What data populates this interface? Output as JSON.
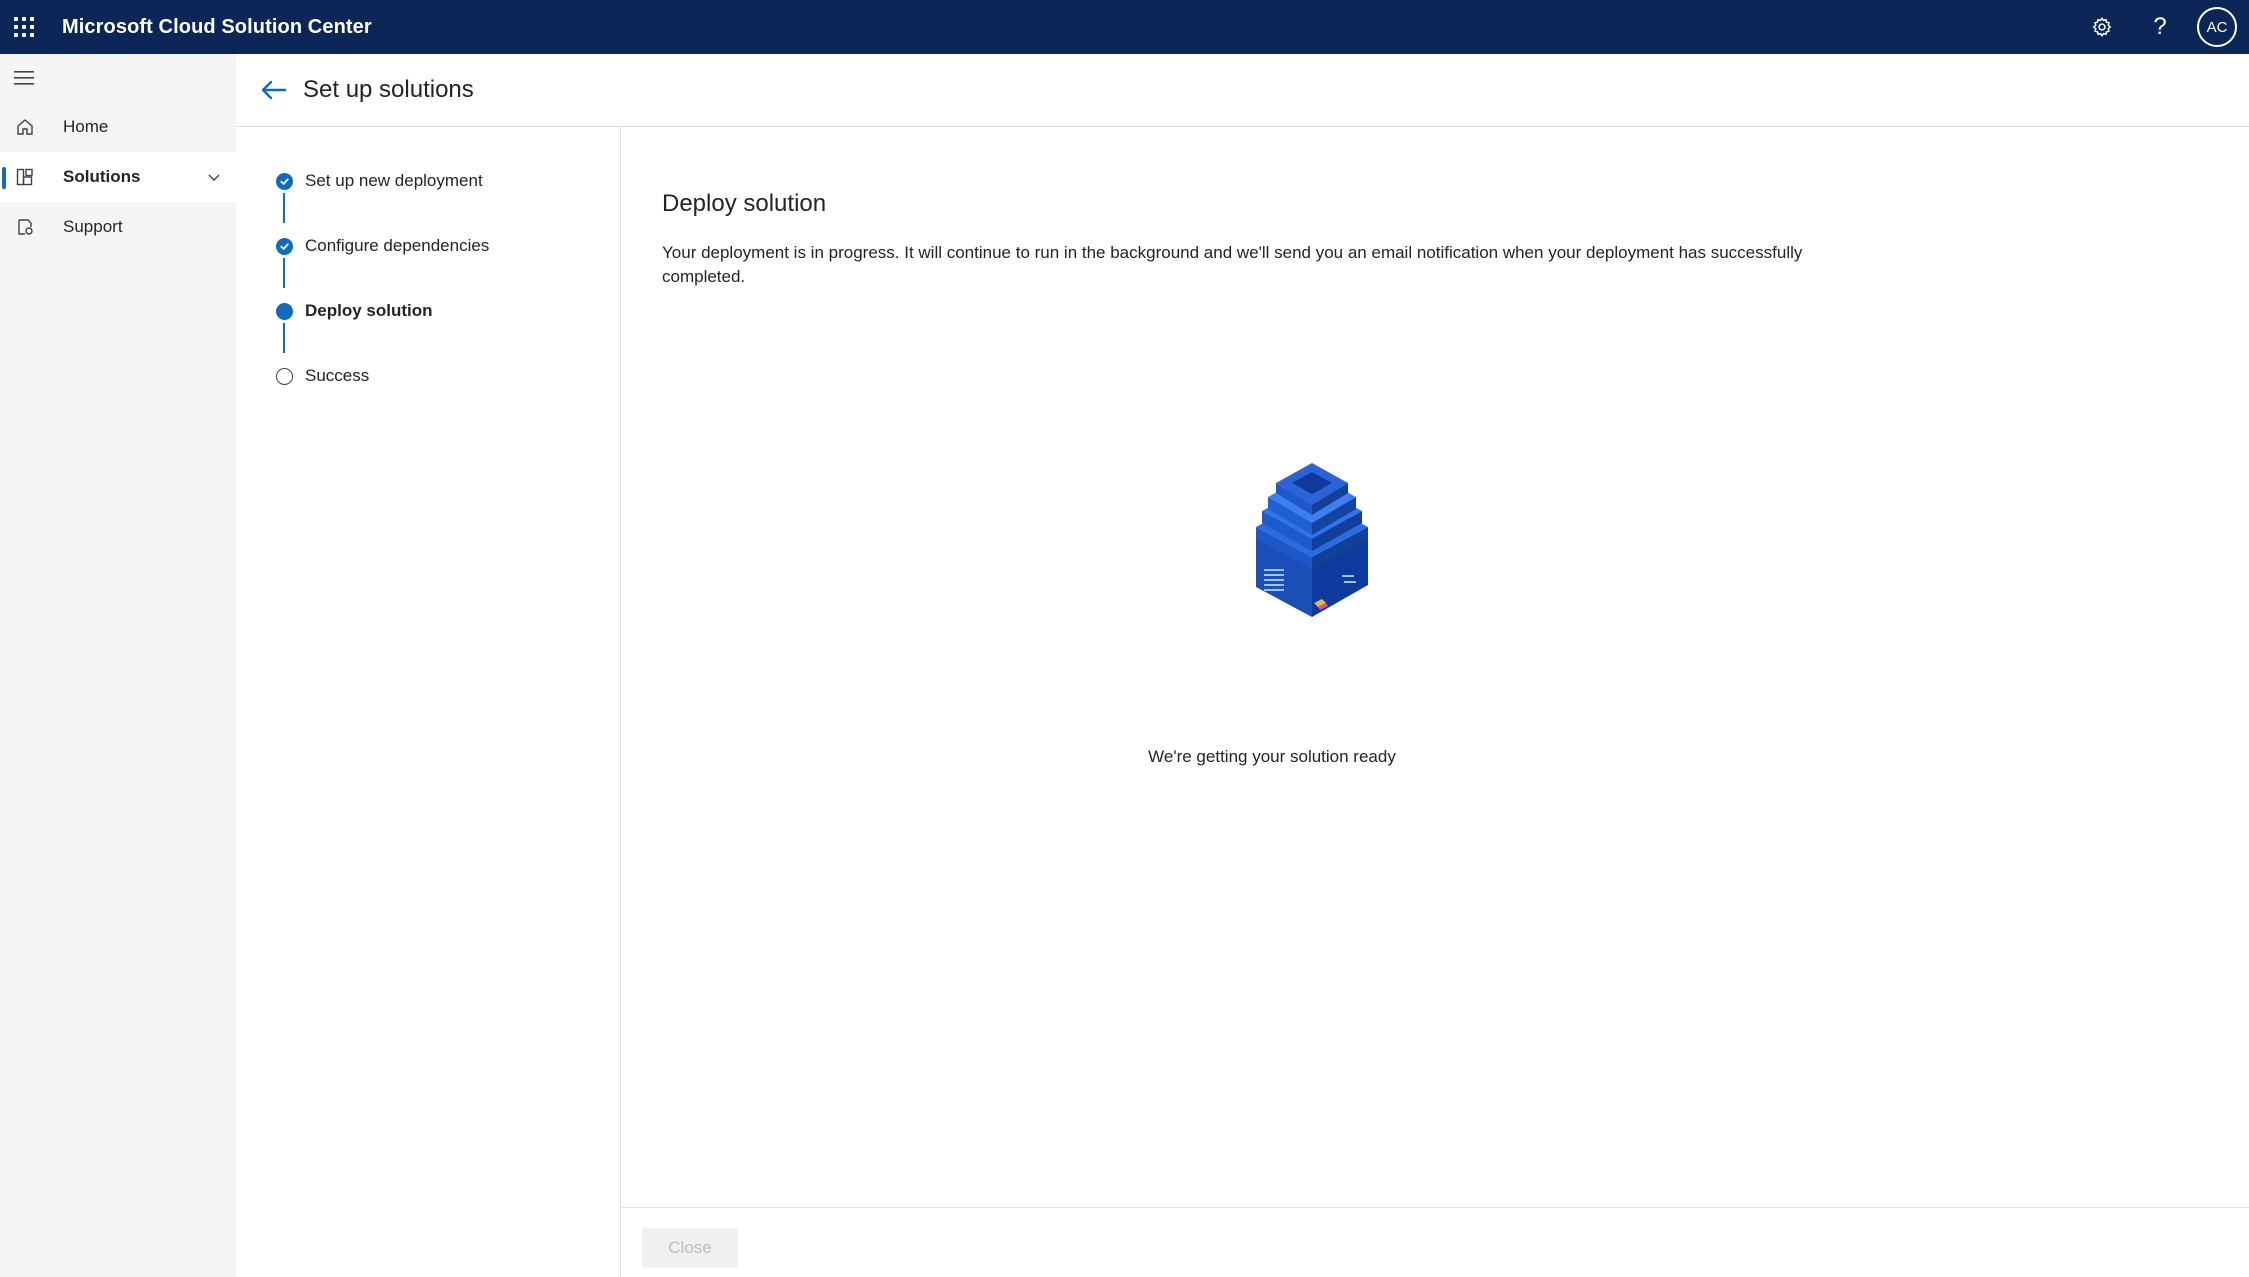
{
  "app": {
    "title": "Microsoft Cloud Solution Center",
    "avatar_initials": "AC",
    "help_glyph": "?"
  },
  "icons": {
    "waffle": "app-launcher-icon",
    "settings": "gear-icon",
    "help": "question-icon",
    "hamburger": "hamburger-icon",
    "back": "arrow-left-icon"
  },
  "nav": {
    "items": [
      {
        "label": "Home",
        "icon": "home-icon",
        "active": false
      },
      {
        "label": "Solutions",
        "icon": "solutions-icon",
        "active": true
      },
      {
        "label": "Support",
        "icon": "support-icon",
        "active": false
      }
    ]
  },
  "header": {
    "title": "Set up solutions"
  },
  "stepper": {
    "steps": [
      {
        "label": "Set up new deployment",
        "state": "done"
      },
      {
        "label": "Configure dependencies",
        "state": "done"
      },
      {
        "label": "Deploy solution",
        "state": "current"
      },
      {
        "label": "Success",
        "state": "pending"
      }
    ]
  },
  "main": {
    "heading": "Deploy solution",
    "description": "Your deployment is in progress. It will continue to run in the background and we'll send you an email notification when your deployment has successfully completed.",
    "status": "We're getting your solution ready"
  },
  "footer": {
    "close_label": "Close"
  },
  "colors": {
    "topbar": "#0c2658",
    "accent": "#0f6cbd",
    "nav_bg": "#f5f5f5"
  }
}
